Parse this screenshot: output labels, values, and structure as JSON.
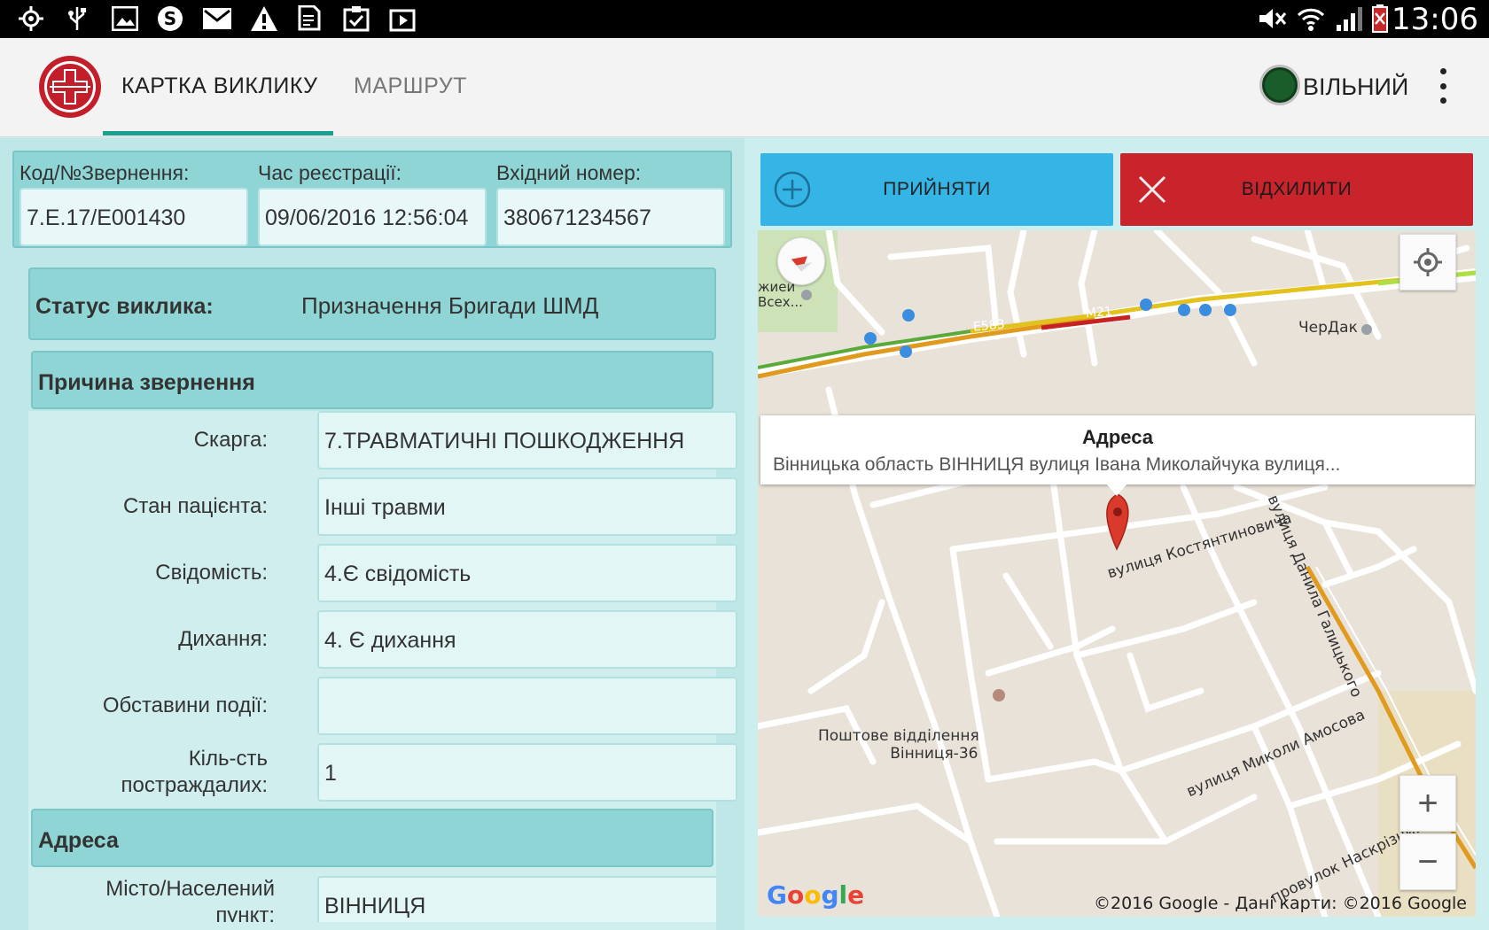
{
  "status_bar": {
    "clock": "13:06"
  },
  "app_bar": {
    "tabs": [
      {
        "label": "КАРТКА ВИКЛИКУ",
        "active": true
      },
      {
        "label": "МАРШРУТ",
        "active": false
      }
    ],
    "status_label": "ВІЛЬНИЙ",
    "status_color": "#1a5d2a"
  },
  "header": {
    "code_label": "Код/№Звернення:",
    "code_value": "7.Е.17/Е001430",
    "time_label": "Час реєстрації:",
    "time_value": "09/06/2016 12:56:04",
    "incoming_label": "Вхідний номер:",
    "incoming_value": "380671234567"
  },
  "call_status": {
    "label": "Статус виклика:",
    "value": "Призначення Бригади ШМД"
  },
  "reason": {
    "title": "Причина звернення",
    "fields": [
      {
        "label": "Скарга:",
        "value": "7.ТРАВМАТИЧНІ  ПОШКОДЖЕННЯ"
      },
      {
        "label": "Стан пацієнта:",
        "value": "Інші травми"
      },
      {
        "label": "Свідомість:",
        "value": "4.Є свідомість"
      },
      {
        "label": "Дихання:",
        "value": "4. Є дихання"
      },
      {
        "label": "Обставини події:",
        "value": ""
      },
      {
        "label_line1": "Кіль-сть",
        "label_line2": "постраждалих:",
        "value": "1"
      }
    ]
  },
  "address": {
    "title": "Адреса",
    "city_label_line1": "Місто/Населений",
    "city_label_line2": "пункт:",
    "city_value": "ВІННИЦЯ"
  },
  "actions": {
    "accept_label": "ПРИЙНЯТИ",
    "reject_label": "ВІДХИЛИТИ",
    "accept_color": "#35b4e6",
    "reject_color": "#c9232b"
  },
  "map": {
    "info_title": "Адреса",
    "info_text": "Вінницька область ВІННИЦЯ вулиця Івана Миколайчука вулиця...",
    "labels": {
      "poi_cherdak": "ЧерДак",
      "post_office_line1": "Поштове відділення",
      "post_office_line2": "Вінниця-36",
      "street_kostiantynovycha": "вулиця Костянтиновича",
      "street_halytskoho": "вулиця Данила Галицького",
      "street_amosova": "вулиця Миколи Амосова",
      "street_naskrizny": "провулок Наскрізний",
      "road_e583": "E583",
      "road_m21": "M21",
      "church_line1": "жией",
      "church_line2": "Всех..."
    },
    "google": "Google",
    "copyright": "©2016 Google - Дані карти: ©2016 Google"
  }
}
